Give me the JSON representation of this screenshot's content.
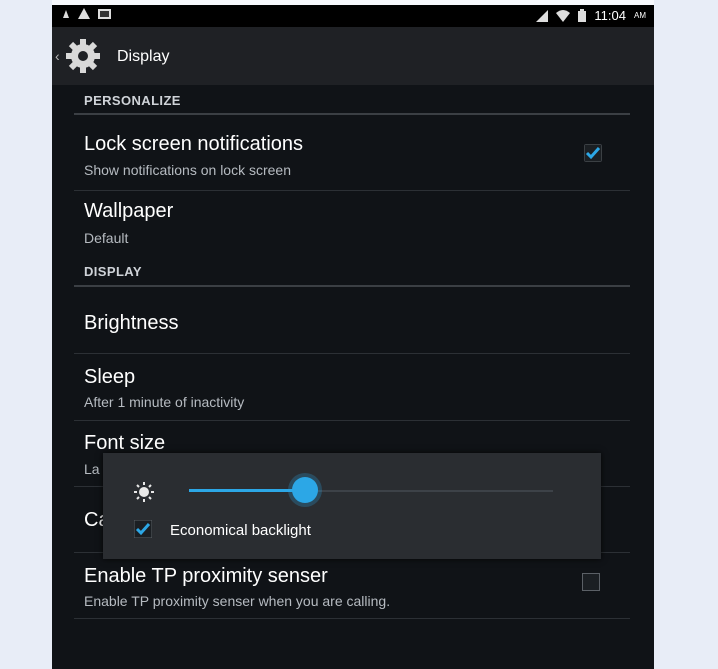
{
  "status_bar": {
    "time": "11:04",
    "ampm": "AM",
    "icons": [
      "notification-icon",
      "warning-icon",
      "photo-icon",
      "signal-icon",
      "wifi-icon",
      "battery-icon"
    ]
  },
  "action_bar": {
    "title": "Display",
    "icon": "gear-icon"
  },
  "sections": {
    "personalize": {
      "header": "PERSONALIZE"
    },
    "display": {
      "header": "DISPLAY"
    }
  },
  "items": {
    "lock_screen": {
      "title": "Lock screen notifications",
      "subtitle": "Show notifications on lock screen",
      "checked": true
    },
    "wallpaper": {
      "title": "Wallpaper",
      "subtitle": "Default"
    },
    "brightness": {
      "title": "Brightness"
    },
    "sleep": {
      "title": "Sleep",
      "subtitle": "After 1 minute of inactivity"
    },
    "font_size": {
      "title": "Font size",
      "subtitle": "La"
    },
    "hidden_item": {
      "title": "Ca"
    },
    "proximity": {
      "title": "Enable TP proximity senser",
      "subtitle": "Enable TP proximity senser when you are calling.",
      "checked": false
    }
  },
  "brightness_dialog": {
    "level": 0.32,
    "checkbox_label": "Economical backlight",
    "checkbox_checked": true,
    "icon": "brightness-sun-icon"
  },
  "colors": {
    "accent": "#2ca7e6",
    "background": "#101317",
    "action_bar": "#1f2125"
  }
}
